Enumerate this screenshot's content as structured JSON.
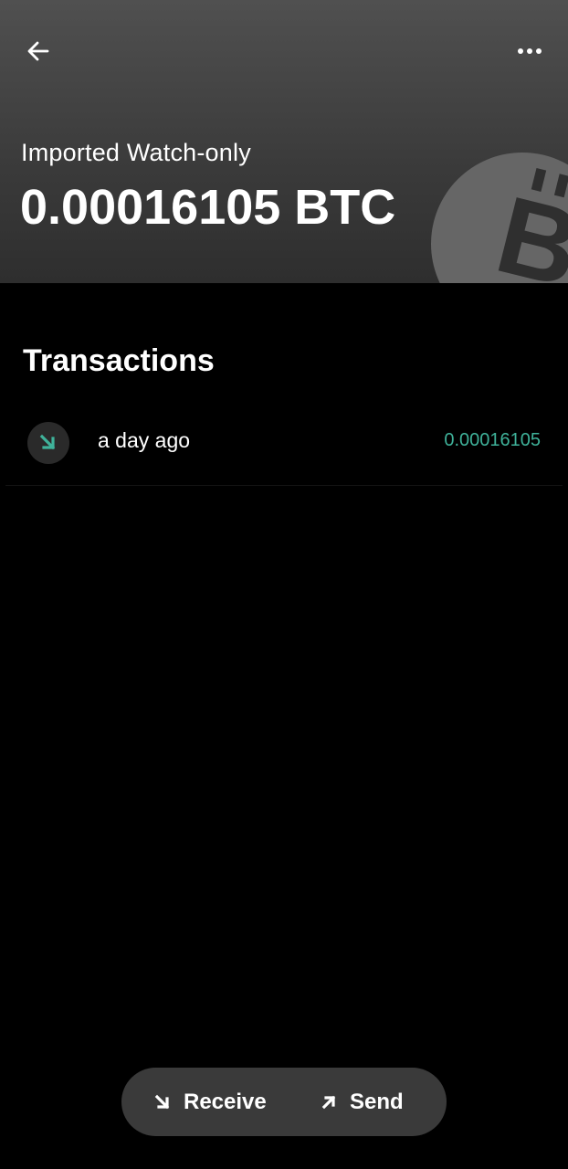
{
  "header": {
    "wallet_label": "Imported Watch-only",
    "balance": "0.00016105 BTC",
    "back_icon": "arrow-left-icon",
    "more_icon": "more-horizontal-icon",
    "logo_icon": "bitcoin-icon"
  },
  "transactions": {
    "title": "Transactions",
    "items": [
      {
        "direction": "incoming",
        "icon": "arrow-down-right-icon",
        "time": "a day ago",
        "amount": "0.00016105"
      }
    ]
  },
  "actions": {
    "receive_label": "Receive",
    "send_label": "Send"
  },
  "colors": {
    "incoming_amount": "#3fb29a",
    "action_bar": "#3a3a3a",
    "background": "#000000"
  }
}
